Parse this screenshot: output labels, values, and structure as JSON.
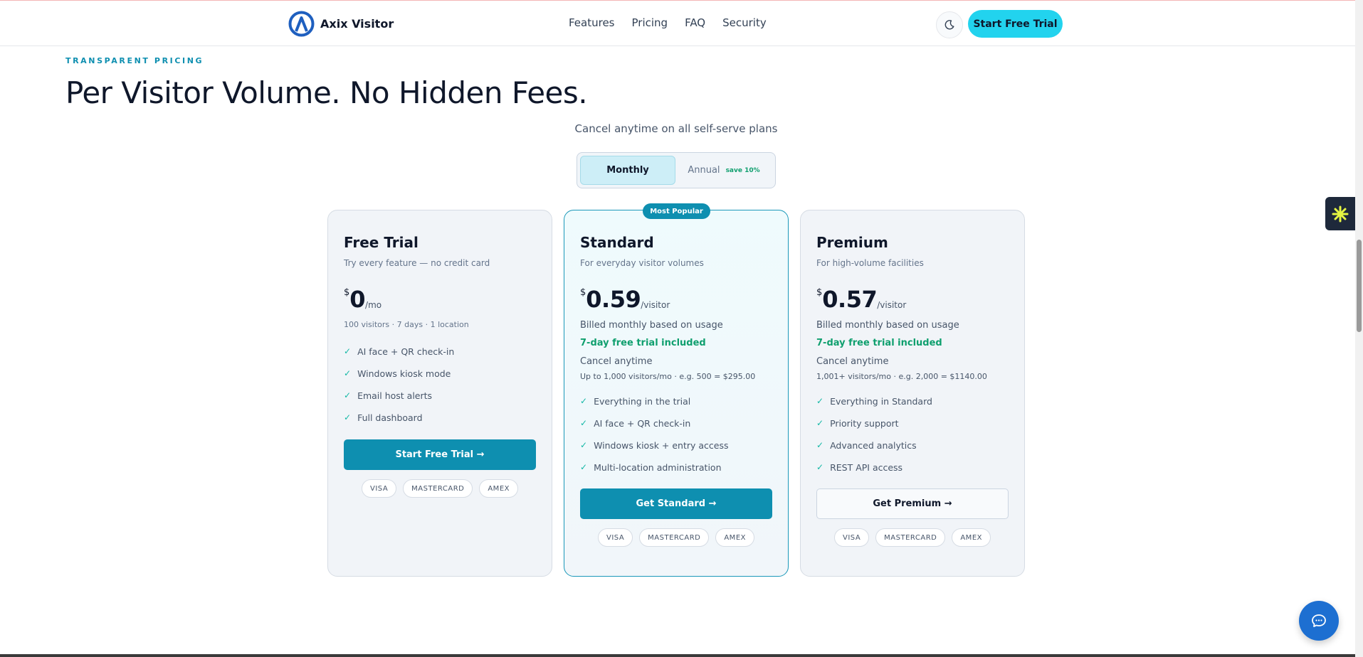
{
  "header": {
    "brand": "Axix Visitor",
    "nav": [
      "Features",
      "Pricing",
      "FAQ",
      "Security"
    ],
    "cta": "Start Free Trial",
    "theme_icon": "moon-icon"
  },
  "hero": {
    "eyebrow": "TRANSPARENT PRICING",
    "title": "Per Visitor Volume. No Hidden Fees.",
    "subtitle": "Cancel anytime on all self-serve plans"
  },
  "billing_toggle": {
    "monthly": "Monthly",
    "annual": "Annual",
    "annual_badge": "save 10%",
    "selected": "Monthly"
  },
  "plans": [
    {
      "name": "Free Trial",
      "desc": "Try every feature — no credit card",
      "currency": "$",
      "price": "0",
      "unit": "/mo",
      "note": "100 visitors · 7 days · 1 location",
      "features": [
        "AI face + QR check-in",
        "Windows kiosk mode",
        "Email host alerts",
        "Full dashboard"
      ],
      "cta": "Start Free Trial →",
      "cards": [
        "VISA",
        "MASTERCARD",
        "AMEX"
      ]
    },
    {
      "name": "Standard",
      "badge": "Most Popular",
      "desc": "For everyday visitor volumes",
      "currency": "$",
      "price": "0.59",
      "unit": "/visitor",
      "billed": "Billed monthly based on usage",
      "trial": "7-day free trial included",
      "cancel": "Cancel anytime",
      "example": "Up to 1,000 visitors/mo · e.g. 500 = $295.00",
      "features": [
        "Everything in the trial",
        "AI face + QR check-in",
        "Windows kiosk + entry access",
        "Multi-location administration"
      ],
      "cta": "Get Standard →",
      "cards": [
        "VISA",
        "MASTERCARD",
        "AMEX"
      ]
    },
    {
      "name": "Premium",
      "desc": "For high-volume facilities",
      "currency": "$",
      "price": "0.57",
      "unit": "/visitor",
      "billed": "Billed monthly based on usage",
      "trial": "7-day free trial included",
      "cancel": "Cancel anytime",
      "example": "1,001+ visitors/mo · e.g. 2,000 = $1140.00",
      "features": [
        "Everything in Standard",
        "Priority support",
        "Advanced analytics",
        "REST API access"
      ],
      "cta": "Get Premium →",
      "cards": [
        "VISA",
        "MASTERCARD",
        "AMEX"
      ]
    }
  ],
  "colors": {
    "accent": "#0e8fb0",
    "cta_cyan": "#22d3ee",
    "success": "#0f9f6e"
  }
}
